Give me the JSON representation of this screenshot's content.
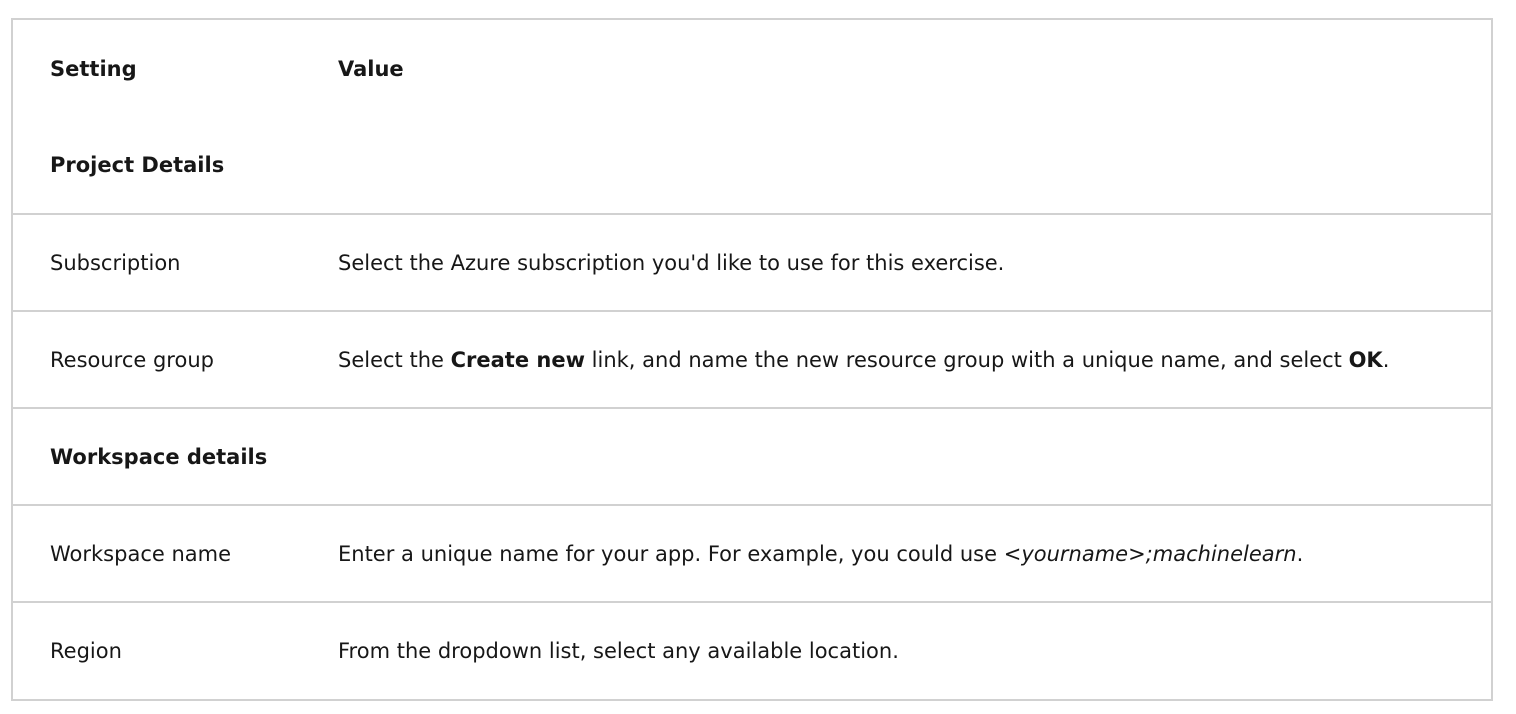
{
  "table": {
    "headers": {
      "setting": "Setting",
      "value": "Value"
    },
    "sections": {
      "project": "Project Details",
      "workspace": "Workspace details"
    },
    "rows": {
      "subscription": {
        "setting": "Subscription",
        "value": "Select the Azure subscription you'd like to use for this exercise."
      },
      "resource_group": {
        "setting": "Resource group",
        "value_pre": "Select the ",
        "value_bold1": "Create new",
        "value_mid": " link, and name the new resource group with a unique name, and select ",
        "value_bold2": "OK",
        "value_post": "."
      },
      "workspace_name": {
        "setting": "Workspace name",
        "value_pre": "Enter a unique name for your app. For example, you could use ",
        "value_italic": "<yourname>;machinelearn",
        "value_post": "."
      },
      "region": {
        "setting": "Region",
        "value": "From the dropdown list, select any available location."
      }
    }
  }
}
